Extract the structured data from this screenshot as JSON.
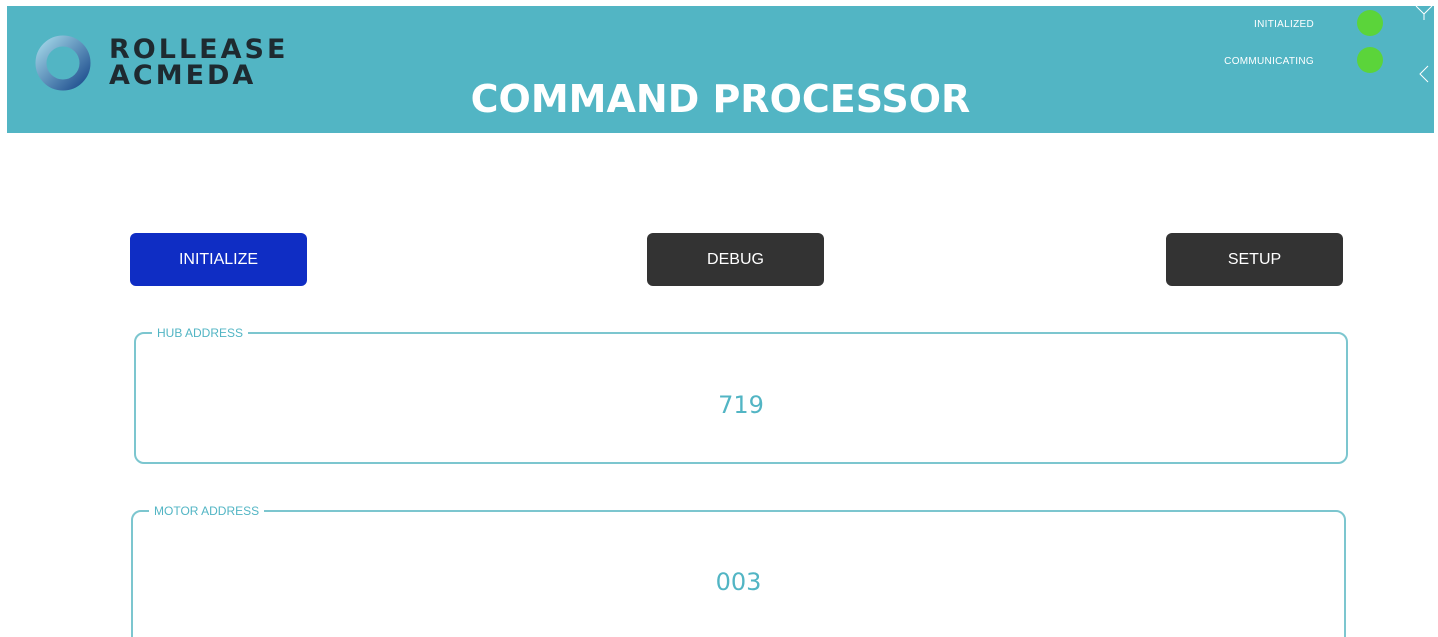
{
  "header": {
    "brand_line1": "ROLLEASE",
    "brand_line2": "ACMEDA",
    "title": "COMMAND PROCESSOR",
    "status": {
      "initialized_label": "INITIALIZED",
      "communicating_label": "COMMUNICATING",
      "indicator_color": "#5bd43a"
    }
  },
  "buttons": {
    "initialize": "INITIALIZE",
    "debug": "DEBUG",
    "setup": "SETUP"
  },
  "fields": {
    "hub_address": {
      "label": "HUB ADDRESS",
      "value": "719"
    },
    "motor_address": {
      "label": "MOTOR ADDRESS",
      "value": "003"
    }
  },
  "colors": {
    "header_bg": "#52b5c4",
    "initialize_bg": "#0f2dc4",
    "dark_button_bg": "#333333",
    "accent": "#52b5c4"
  }
}
